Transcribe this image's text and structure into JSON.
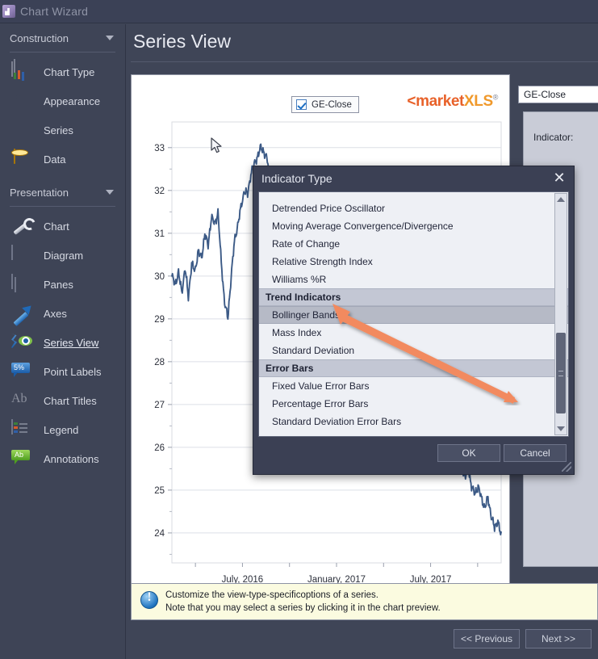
{
  "window": {
    "title": "Chart Wizard",
    "icon": "app-icon"
  },
  "page": {
    "title": "Series View"
  },
  "sidebar": {
    "groups": [
      {
        "label": "Construction",
        "items": [
          {
            "label": "Chart Type",
            "icon": "chart-type-icon"
          },
          {
            "label": "Appearance",
            "icon": "palette-icon"
          },
          {
            "label": "Series",
            "icon": "series-icon"
          },
          {
            "label": "Data",
            "icon": "database-icon"
          }
        ]
      },
      {
        "label": "Presentation",
        "items": [
          {
            "label": "Chart",
            "icon": "wrench-icon"
          },
          {
            "label": "Diagram",
            "icon": "grid-icon"
          },
          {
            "label": "Panes",
            "icon": "panes-icon"
          },
          {
            "label": "Axes",
            "icon": "arrow-up-right-icon"
          },
          {
            "label": "Series View",
            "icon": "eye-wave-icon",
            "selected": true
          },
          {
            "label": "Point Labels",
            "icon": "percent-label-icon"
          },
          {
            "label": "Chart Titles",
            "icon": "ab-text-icon"
          },
          {
            "label": "Legend",
            "icon": "legend-icon"
          },
          {
            "label": "Annotations",
            "icon": "annotation-icon"
          }
        ]
      }
    ]
  },
  "chart_preview": {
    "legend_item": {
      "label": "GE-Close",
      "checked": true
    },
    "brand": {
      "left": "<market",
      "mid": "XLS",
      "reg": "®"
    }
  },
  "chart_data": {
    "type": "line",
    "title": "",
    "xlabel": "",
    "ylabel": "",
    "series_name": "GE-Close",
    "line_color": "#3c5a86",
    "grid": true,
    "ylim": [
      23.3,
      33.6
    ],
    "yticks": [
      24,
      25,
      26,
      27,
      28,
      29,
      30,
      31,
      32,
      33
    ],
    "xticks": [
      "July, 2016",
      "January, 2017",
      "July, 2017"
    ],
    "x": [
      0,
      1,
      2,
      3,
      4,
      5,
      6,
      7,
      8,
      9,
      10,
      11,
      12,
      13,
      14,
      15,
      16,
      17,
      18,
      19,
      20,
      21,
      22,
      23,
      24,
      25,
      26,
      27,
      28,
      29,
      30,
      31,
      32,
      33,
      34,
      35,
      36,
      37,
      38,
      39,
      40,
      41,
      42,
      43,
      44,
      45,
      46,
      47,
      48,
      49,
      50,
      51,
      52,
      53,
      54,
      55,
      56,
      57,
      58,
      59,
      60,
      61,
      62,
      63,
      64,
      65,
      66,
      67,
      68,
      69,
      70,
      71,
      72,
      73,
      74,
      75,
      76,
      77,
      78,
      79,
      80,
      81,
      82,
      83,
      84,
      85,
      86,
      87,
      88,
      89,
      90,
      91,
      92,
      93,
      94,
      95,
      96,
      97,
      98,
      99,
      100
    ],
    "values": [
      30.0,
      29.8,
      30.1,
      29.6,
      30.2,
      29.5,
      30.3,
      30.1,
      30.6,
      30.4,
      31.0,
      30.7,
      31.4,
      31.2,
      31.5,
      30.3,
      29.4,
      29.0,
      30.0,
      30.8,
      31.2,
      31.6,
      32.0,
      31.9,
      32.4,
      32.6,
      32.8,
      33.0,
      32.9,
      32.7,
      32.2,
      31.6,
      31.2,
      31.0,
      31.3,
      31.1,
      31.4,
      31.2,
      31.5,
      31.2,
      31.0,
      31.3,
      31.5,
      31.2,
      31.4,
      31.3,
      31.1,
      31.3,
      31.2,
      31.1,
      31.0,
      30.9,
      30.6,
      30.1,
      29.8,
      30.0,
      29.7,
      29.5,
      29.8,
      29.5,
      29.2,
      29.0,
      29.4,
      29.6,
      29.8,
      29.5,
      29.2,
      28.9,
      29.1,
      28.8,
      28.5,
      28.2,
      28.4,
      28.0,
      27.7,
      27.9,
      27.5,
      27.2,
      27.4,
      27.0,
      26.7,
      26.9,
      26.5,
      26.2,
      26.4,
      26.0,
      25.8,
      26.0,
      25.6,
      25.3,
      25.5,
      25.1,
      24.9,
      25.1,
      24.8,
      24.6,
      24.8,
      24.4,
      24.1,
      24.3,
      23.9
    ]
  },
  "right_panel": {
    "series_selector": "GE-Close",
    "indicator_label": "Indicator:",
    "indicator_value": ""
  },
  "info": {
    "line1": "Customize the view-type-specificoptions of a series.",
    "line2": "Note that you may select a series by clicking it in the chart preview."
  },
  "footer": {
    "previous": "<< Previous",
    "next": "Next >>"
  },
  "dialog": {
    "title": "Indicator Type",
    "close": "✕",
    "items": [
      {
        "label": "",
        "kind": "partial"
      },
      {
        "label": "Detrended Price Oscillator",
        "kind": "item"
      },
      {
        "label": "Moving Average Convergence/Divergence",
        "kind": "item"
      },
      {
        "label": "Rate of Change",
        "kind": "item"
      },
      {
        "label": "Relative Strength Index",
        "kind": "item"
      },
      {
        "label": "Williams %R",
        "kind": "item"
      },
      {
        "label": "Trend Indicators",
        "kind": "group"
      },
      {
        "label": "Bollinger Bands",
        "kind": "selected"
      },
      {
        "label": "Mass Index",
        "kind": "item"
      },
      {
        "label": "Standard Deviation",
        "kind": "item"
      },
      {
        "label": "Error Bars",
        "kind": "group"
      },
      {
        "label": "Fixed Value Error Bars",
        "kind": "item"
      },
      {
        "label": "Percentage Error Bars",
        "kind": "item"
      },
      {
        "label": "Standard Deviation Error Bars",
        "kind": "item"
      }
    ],
    "ok": "OK",
    "cancel": "Cancel"
  },
  "annotation": {
    "arrow_color": "#f08a5d"
  },
  "colors": {
    "app_bg": "#3f4557",
    "sidebar_bg": "#3e4456",
    "accent_orange": "#f08a5d",
    "chart_line": "#3c5a86",
    "info_bg": "#fbfbe0"
  }
}
